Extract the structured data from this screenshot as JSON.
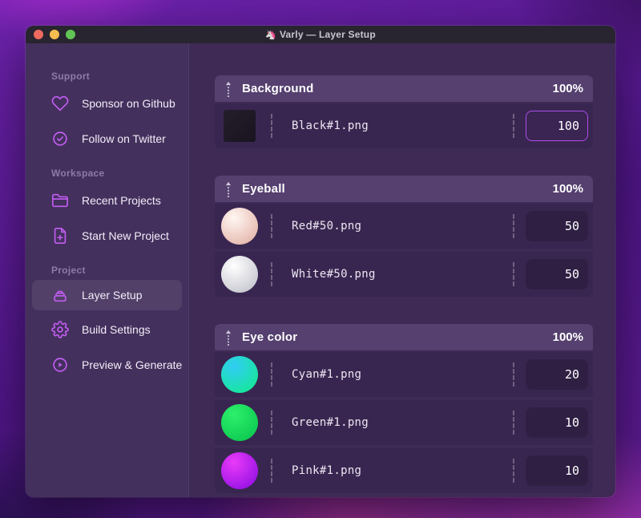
{
  "window": {
    "title": "Varly — Layer Setup",
    "title_icon": "🦄",
    "traffic_colors": {
      "close": "#ee6a5f",
      "minimize": "#f5bd4f",
      "zoom": "#61c454"
    }
  },
  "colors": {
    "accent_icon": "#c25df2",
    "focus_border": "#ad4ceb",
    "header_bar": "#55406f",
    "sidebar_bg": "#44305d",
    "main_bg": "#3e2a55",
    "row_bg": "#392650"
  },
  "sidebar": {
    "sections": [
      {
        "label": "Support",
        "items": [
          {
            "label": "Sponsor on Github",
            "icon": "heart-icon",
            "selected": false
          },
          {
            "label": "Follow on Twitter",
            "icon": "check-badge-icon",
            "selected": false
          }
        ]
      },
      {
        "label": "Workspace",
        "items": [
          {
            "label": "Recent Projects",
            "icon": "folder-icon",
            "selected": false
          },
          {
            "label": "Start New Project",
            "icon": "file-plus-icon",
            "selected": false
          }
        ]
      },
      {
        "label": "Project",
        "items": [
          {
            "label": "Layer Setup",
            "icon": "layers-icon",
            "selected": true
          },
          {
            "label": "Build Settings",
            "icon": "gear-icon",
            "selected": false
          },
          {
            "label": "Preview & Generate",
            "icon": "play-circle-icon",
            "selected": false
          }
        ]
      }
    ]
  },
  "main": {
    "groups": [
      {
        "name": "Background",
        "weight": "100%",
        "layers": [
          {
            "file": "Black#1.png",
            "value": "100",
            "focused": true,
            "thumb_shape": "square",
            "thumb_colors": [
              "#241e2b",
              "#191420"
            ]
          }
        ]
      },
      {
        "name": "Eyeball",
        "weight": "100%",
        "layers": [
          {
            "file": "Red#50.png",
            "value": "50",
            "focused": false,
            "thumb_shape": "ball",
            "thumb_colors": [
              "#fff7f3",
              "#e6b9ae"
            ]
          },
          {
            "file": "White#50.png",
            "value": "50",
            "focused": false,
            "thumb_shape": "ball",
            "thumb_colors": [
              "#ffffff",
              "#c9c9d2"
            ]
          }
        ]
      },
      {
        "name": "Eye color",
        "weight": "100%",
        "layers": [
          {
            "file": "Cyan#1.png",
            "value": "20",
            "focused": false,
            "thumb_shape": "ball",
            "thumb_colors": [
              "#31cdf6",
              "#17e69c"
            ]
          },
          {
            "file": "Green#1.png",
            "value": "10",
            "focused": false,
            "thumb_shape": "ball",
            "thumb_colors": [
              "#2df06b",
              "#0ecb52"
            ]
          },
          {
            "file": "Pink#1.png",
            "value": "10",
            "focused": false,
            "thumb_shape": "ball",
            "thumb_colors": [
              "#e93af8",
              "#9a14e6"
            ]
          }
        ]
      }
    ]
  }
}
